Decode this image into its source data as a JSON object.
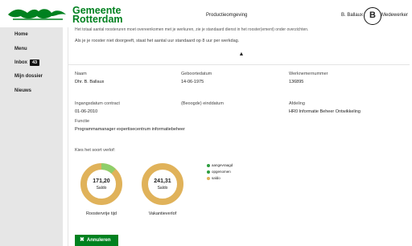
{
  "header": {
    "brand_line1": "Gemeente",
    "brand_line2": "Rotterdam",
    "environment": "Productieomgeving",
    "user_name": "B. Ballaux",
    "avatar_initial": "B",
    "role": "Medewerker",
    "brand_color": "#00811f"
  },
  "sidebar": {
    "items": [
      {
        "label": "Home"
      },
      {
        "label": "Menu"
      },
      {
        "label": "Inbox",
        "badge": "43"
      },
      {
        "label": "Mijn dossier"
      },
      {
        "label": "Nieuws"
      }
    ]
  },
  "main": {
    "top_text": "Het totaal aantal roosteruren moet overeenkomen met je werkuren, zie je standaard dienst in het rooster(ement) onder overzichten.",
    "info_text": "Als je je rooster niet doorgeeft, staat het aantal uur standaard op 8 uur per werkdag.",
    "chevron_icon": "chevron-up-icon",
    "fields": {
      "naam_label": "Naam",
      "naam_value": "Dhr. B. Ballaux",
      "geboortedatum_label": "Geboortedatum",
      "geboortedatum_value": "14-06-1975",
      "werknemernummer_label": "Werknemernummer",
      "werknemernummer_value": "136895",
      "ingangsdatum_label": "Ingangsdatum contract",
      "ingangsdatum_value": "01-06-2010",
      "einddatum_label": "(Beoogde) einddatum",
      "einddatum_value": "",
      "afdeling_label": "Afdeling",
      "afdeling_value": "HR0 Informatie Beheer Ontwikkeling",
      "functie_label": "Functie",
      "functie_value": "Programmamanager expertisecentrum informatiebeheer"
    },
    "leave_title": "Kies het soort verlof:",
    "legend": [
      {
        "label": "aangevraagd",
        "color": "#2e9e3f"
      },
      {
        "label": "opgenomen",
        "color": "#2e9e3f"
      },
      {
        "label": "saldo",
        "color": "#e0b25a"
      }
    ],
    "donuts": [
      {
        "value": "171,20",
        "sublabel": "Saldo",
        "caption": "Roostervrije tijd",
        "used_fraction": 0.12,
        "used_color": "#8fcf6a",
        "saldo_color": "#e0b25a"
      },
      {
        "value": "241,31",
        "sublabel": "Saldo",
        "caption": "Vakantieverlof",
        "used_fraction": 0.0,
        "used_color": "#8fcf6a",
        "saldo_color": "#e0b25a"
      }
    ],
    "cancel_label": "Annuleren"
  }
}
